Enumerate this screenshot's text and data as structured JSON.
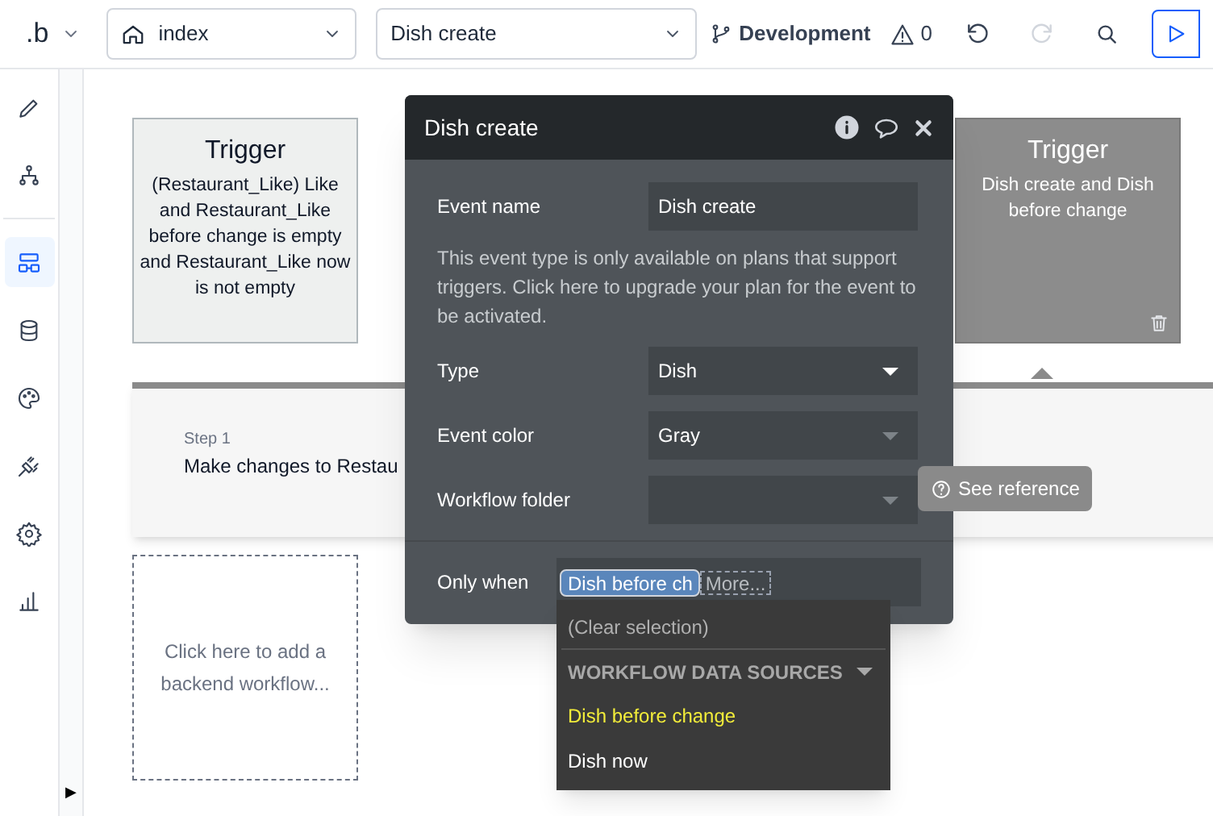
{
  "toolbar": {
    "logo": ".b",
    "page_select": "index",
    "workflow_select": "Dish create",
    "branch": "Development",
    "issue_count": "0"
  },
  "sidebar": {
    "items": [
      {
        "kind": "pencil",
        "selected": false
      },
      {
        "kind": "tree",
        "selected": false
      },
      {
        "kind": "workflow",
        "selected": true
      },
      {
        "kind": "database",
        "selected": false
      },
      {
        "kind": "palette",
        "selected": false
      },
      {
        "kind": "plug",
        "selected": false
      },
      {
        "kind": "gear",
        "selected": false
      },
      {
        "kind": "chart",
        "selected": false
      }
    ],
    "expand": "▶"
  },
  "canvas": {
    "triggers": [
      {
        "title": "Trigger",
        "text": "(Restaurant_Like) Like and Restaurant_Like before change is empty and Restaurant_Like now is not empty",
        "selected": false
      },
      {
        "title": "Trigger",
        "text": "Dish create and Dish before change",
        "selected": true
      }
    ],
    "step": {
      "label": "Step 1",
      "text": "Make changes to Restau"
    },
    "add_placeholder": "Click here to add a backend workflow...",
    "reference_button": "See reference"
  },
  "dialog": {
    "title": "Dish create",
    "event_name_label": "Event name",
    "event_name": "Dish create",
    "notice": "This event type is only available on plans that support triggers. Click here to upgrade your plan for the event to be activated.",
    "selects": [
      {
        "label": "Type",
        "value": "Dish",
        "disabled": false
      },
      {
        "label": "Event color",
        "value": "Gray",
        "disabled": true
      },
      {
        "label": "Workflow folder",
        "disabled": true
      }
    ],
    "only_when_label": "Only when",
    "condition_chip": "Dish before ch",
    "more_chip": "More..."
  },
  "dropdown": {
    "clear": "(Clear selection)",
    "section": "WORKFLOW DATA SOURCES",
    "options": [
      {
        "label": "Dish before change",
        "selected": true
      },
      {
        "label": "Dish now",
        "selected": false
      }
    ]
  }
}
